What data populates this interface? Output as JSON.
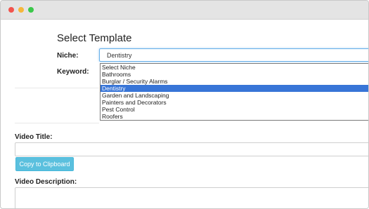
{
  "form": {
    "heading": "Select Template",
    "niche_label": "Niche:",
    "keyword_label": "Keyword:",
    "niche_selected": "Dentistry",
    "niche_options": [
      "Select Niche",
      "Bathrooms",
      "Burglar / Security Alarms",
      "Dentistry",
      "Garden and Landscaping",
      "Painters and Decorators",
      "Pest Control",
      "Roofers"
    ],
    "video_title_label": "Video Title:",
    "copy_button": "Copy to Clipboard",
    "video_description_label": "Video Description:"
  },
  "colors": {
    "window_close": "#f2544d",
    "window_minimize": "#f6b73a",
    "window_maximize": "#3bc84a",
    "button": "#5bc0de",
    "highlight": "#3875d7",
    "focus": "#66afe9"
  }
}
